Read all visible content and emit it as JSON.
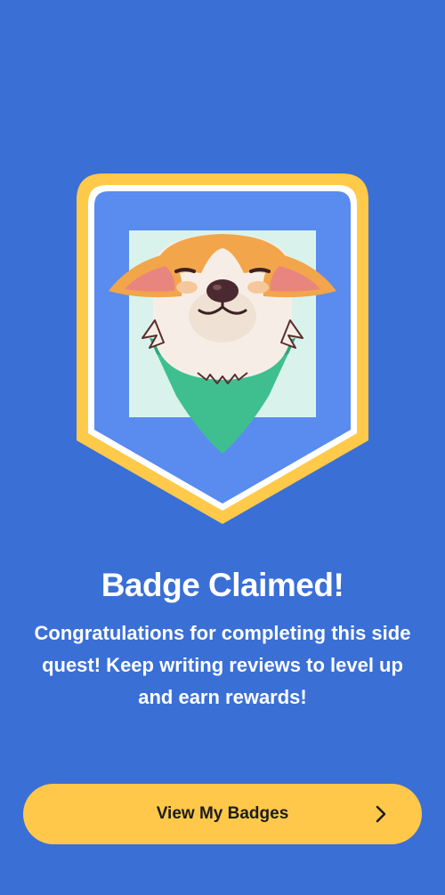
{
  "badge": {
    "icon": "corgi-badge-icon"
  },
  "content": {
    "title": "Badge Claimed!",
    "message": "Congratulations for completing this side quest! Keep writing reviews to level up and earn rewards!"
  },
  "cta": {
    "label": "View My Badges",
    "icon": "chevron-right-icon"
  },
  "colors": {
    "background": "#3A6FD6",
    "badge_border": "#FFC94A",
    "badge_fill": "#5A8BEF",
    "button": "#FFC84A",
    "bandana": "#3FBF8F"
  }
}
